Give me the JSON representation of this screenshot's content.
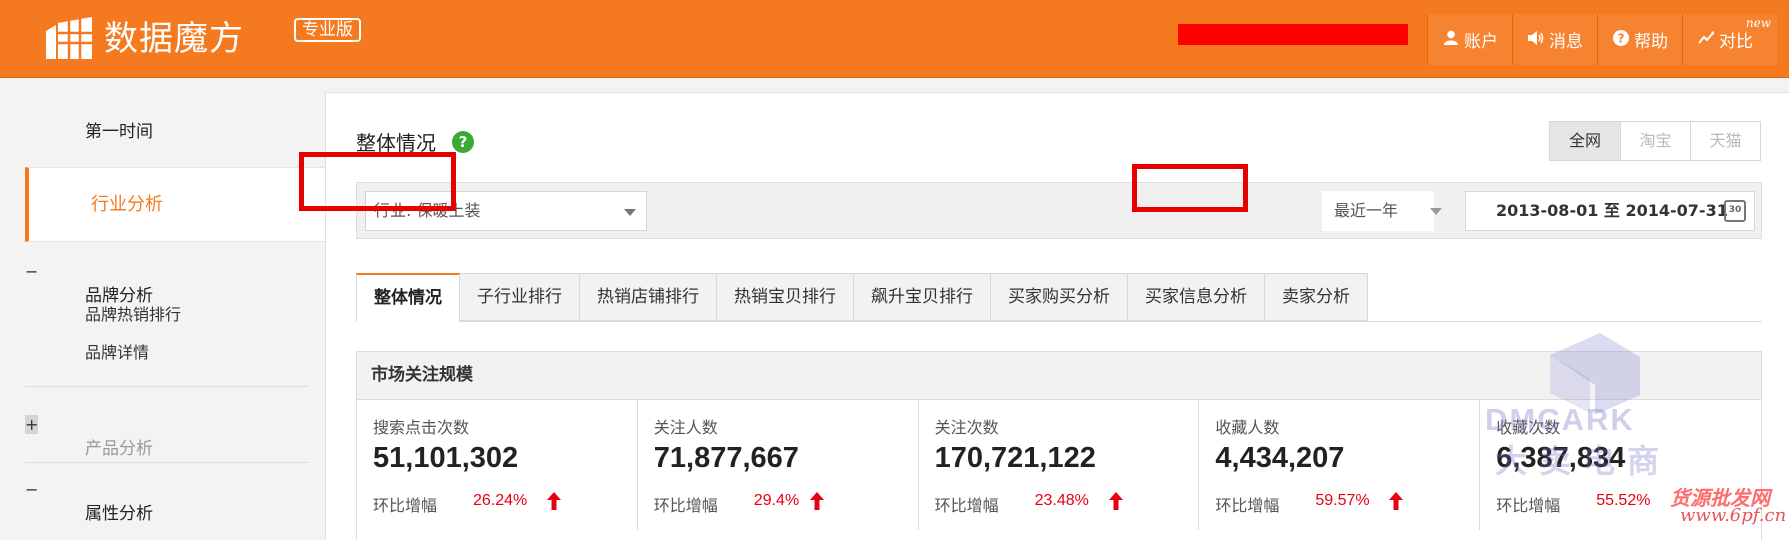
{
  "header": {
    "logo_text": "数据魔方",
    "logo_badge": "专业版",
    "nav": [
      {
        "icon": "user-icon",
        "label": "账户"
      },
      {
        "icon": "speaker-icon",
        "label": "消息"
      },
      {
        "icon": "question-icon",
        "label": "帮助"
      },
      {
        "icon": "compare-icon",
        "label": "对比",
        "tag": "new"
      }
    ]
  },
  "sidebar": {
    "first_time": "第一时间",
    "industry_analysis": "行业分析",
    "brand_group": "品牌分析",
    "brand_items": [
      "品牌热销排行",
      "品牌详情"
    ],
    "product_group": "产品分析",
    "attribute_group": "属性分析"
  },
  "main": {
    "title": "整体情况",
    "help": "?",
    "scope_tabs": [
      "全网",
      "淘宝",
      "天猫"
    ],
    "industry_select": "行业: 保暖上装",
    "period_select": "最近一年",
    "date_range": "2013-08-01 至 2014-07-31",
    "calendar_number": "30",
    "tabs": [
      "整体情况",
      "子行业排行",
      "热销店铺排行",
      "热销宝贝排行",
      "飙升宝贝排行",
      "买家购买分析",
      "买家信息分析",
      "卖家分析"
    ],
    "panel_title": "市场关注规模",
    "mom_label": "环比增幅",
    "stats": [
      {
        "label": "搜索点击次数",
        "value": "51,101,302",
        "change": "26.24%"
      },
      {
        "label": "关注人数",
        "value": "71,877,667",
        "change": "29.4%"
      },
      {
        "label": "关注次数",
        "value": "170,721,122",
        "change": "23.48%"
      },
      {
        "label": "收藏人数",
        "value": "4,434,207",
        "change": "59.57%"
      },
      {
        "label": "收藏次数",
        "value": "6,387,834",
        "change": "55.52%"
      }
    ]
  },
  "watermark": {
    "brand": "DMCARK",
    "cn": "大卖电商",
    "site_cn": "货源批发网",
    "site": "www.6pf.cn"
  },
  "colors": {
    "brand": "#f57a1f",
    "positive": "#e60012",
    "highlight_frame": "#e60000"
  }
}
